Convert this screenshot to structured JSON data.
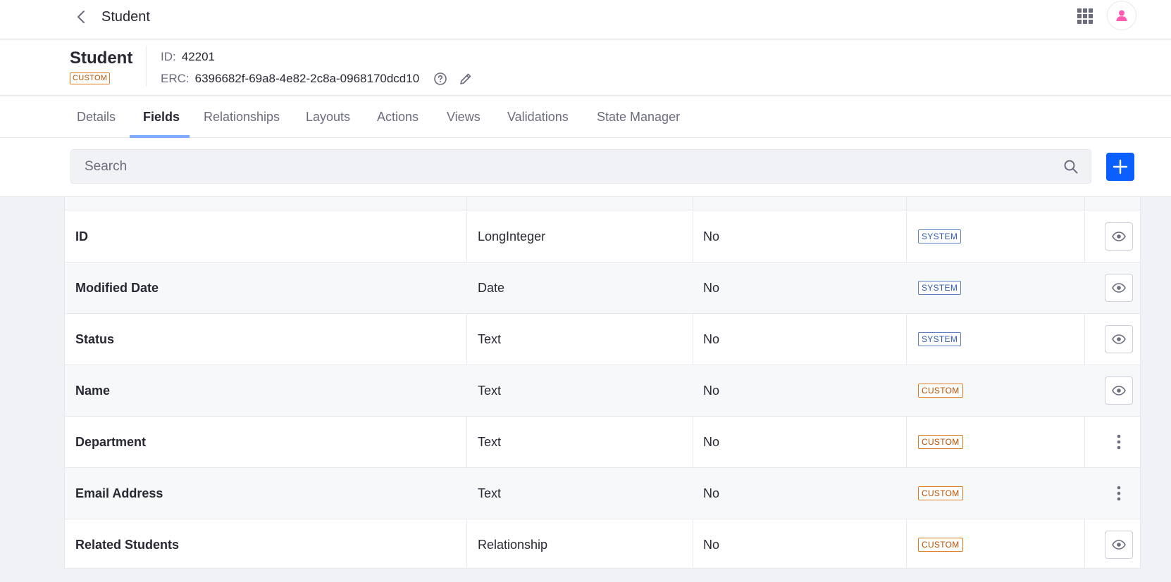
{
  "topbar": {
    "title": "Student"
  },
  "header": {
    "title": "Student",
    "badge": "CUSTOM",
    "id_label": "ID:",
    "id_value": "42201",
    "erc_label": "ERC:",
    "erc_value": "6396682f-69a8-4e82-2c8a-0968170dcd10"
  },
  "tabs": [
    {
      "label": "Details"
    },
    {
      "label": "Fields",
      "active": true
    },
    {
      "label": "Relationships"
    },
    {
      "label": "Layouts"
    },
    {
      "label": "Actions"
    },
    {
      "label": "Views"
    },
    {
      "label": "Validations"
    },
    {
      "label": "State Manager"
    }
  ],
  "search": {
    "placeholder": "Search"
  },
  "table": {
    "rows": [
      {
        "name": "ID",
        "type": "LongInteger",
        "mandatory": "No",
        "source": "SYSTEM",
        "action": "view"
      },
      {
        "name": "Modified Date",
        "type": "Date",
        "mandatory": "No",
        "source": "SYSTEM",
        "action": "view"
      },
      {
        "name": "Status",
        "type": "Text",
        "mandatory": "No",
        "source": "SYSTEM",
        "action": "view"
      },
      {
        "name": "Name",
        "type": "Text",
        "mandatory": "No",
        "source": "CUSTOM",
        "action": "view"
      },
      {
        "name": "Department",
        "type": "Text",
        "mandatory": "No",
        "source": "CUSTOM",
        "action": "menu"
      },
      {
        "name": "Email Address",
        "type": "Text",
        "mandatory": "No",
        "source": "CUSTOM",
        "action": "menu"
      },
      {
        "name": "Related Students",
        "type": "Relationship",
        "mandatory": "No",
        "source": "CUSTOM",
        "action": "view"
      }
    ]
  },
  "colors": {
    "accent": "#0b5fff",
    "tab_underline": "#80acff",
    "system_badge": "#2e5aac",
    "custom_badge": "#b95000",
    "avatar_icon": "#ff5bb0"
  }
}
